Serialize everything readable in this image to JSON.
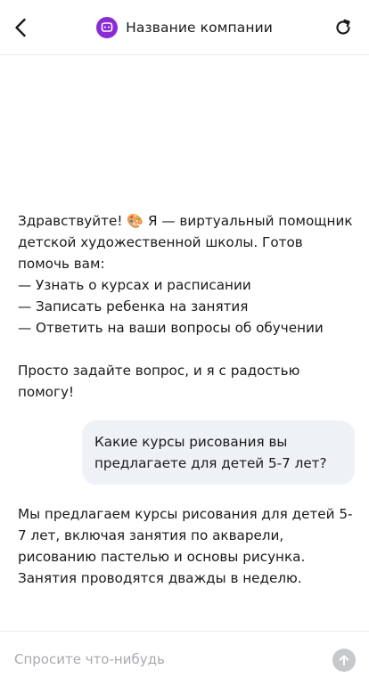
{
  "header": {
    "title": "Название компании",
    "back_icon": "chevron-left-icon",
    "refresh_icon": "refresh-icon",
    "logo_icon": "chat-bot-icon",
    "logo_color": "#8a2bd6"
  },
  "messages": {
    "bot_greeting": {
      "line1_before_emoji": "Здравствуйте! ",
      "emoji": "🎨",
      "line1_after_emoji": " Я — виртуальный помощник детской художественной школы. Готов помочь вам:",
      "item1": "— Узнать о курсах и расписании",
      "item2": "— Записать ребенка на занятия",
      "item3": "— Ответить на ваши вопросы об обучении",
      "closing": "Просто задайте вопрос, и я с радостью помогу!"
    },
    "user_question": "Какие курсы рисования вы предлагаете для детей 5-7 лет?",
    "bot_answer": "Мы предлагаем курсы рисования для детей 5-7 лет, включая занятия по акварели, рисованию пастелью и основы рисунка. Занятия проводятся дважды в неделю."
  },
  "composer": {
    "placeholder": "Спросите что-нибудь",
    "value": "",
    "send_icon": "arrow-up-icon",
    "send_color": "#c6c8cc"
  },
  "colors": {
    "user_bubble": "#eef1f5",
    "divider": "#ececec"
  }
}
